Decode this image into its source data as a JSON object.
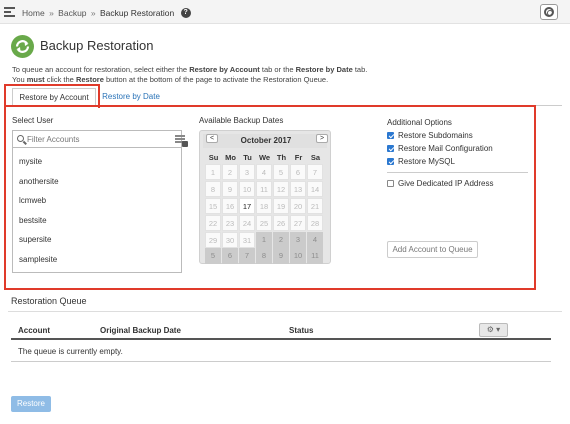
{
  "breadcrumb": {
    "home": "Home",
    "sep1": "»",
    "section": "Backup",
    "sep2": "»",
    "current": "Backup Restoration",
    "help": "?"
  },
  "page": {
    "title": "Backup Restoration",
    "intro_1a": "To queue an account for restoration, select either the ",
    "intro_1b": "Restore by Account",
    "intro_1c": " tab or the ",
    "intro_1d": "Restore by Date",
    "intro_1e": " tab.",
    "intro_2a": "You ",
    "intro_2b": "must",
    "intro_2c": " click the ",
    "intro_2d": "Restore",
    "intro_2e": " button at the bottom of the page to activate the Restoration Queue."
  },
  "tabs": [
    {
      "label": "Restore by Account",
      "active": true
    },
    {
      "label": "Restore by Date",
      "active": false
    }
  ],
  "select_user": {
    "label": "Select User",
    "placeholder": "Filter Accounts",
    "accounts": [
      "mysite",
      "anothersite",
      "lcmweb",
      "bestsite",
      "supersite",
      "samplesite"
    ]
  },
  "calendar": {
    "label": "Available Backup Dates",
    "prev": "<",
    "next": ">",
    "month": "October 2017",
    "weekdays": [
      "Su",
      "Mo",
      "Tu",
      "We",
      "Th",
      "Fr",
      "Sa"
    ],
    "weeks": [
      [
        "1",
        "2",
        "3",
        "4",
        "5",
        "6",
        "7"
      ],
      [
        "8",
        "9",
        "10",
        "11",
        "12",
        "13",
        "14"
      ],
      [
        "15",
        "16",
        "17",
        "18",
        "19",
        "20",
        "21"
      ],
      [
        "22",
        "23",
        "24",
        "25",
        "26",
        "27",
        "28"
      ],
      [
        "29",
        "30",
        "31",
        "1",
        "2",
        "3",
        "4"
      ],
      [
        "5",
        "6",
        "7",
        "8",
        "9",
        "10",
        "11"
      ]
    ],
    "available_day": "17"
  },
  "options": {
    "label": "Additional Options",
    "restore_subdomains": "Restore Subdomains",
    "restore_mail": "Restore Mail Configuration",
    "restore_mysql": "Restore MySQL",
    "dedicated_ip": "Give Dedicated IP Address",
    "add_button": "Add Account to Queue"
  },
  "queue": {
    "title": "Restoration Queue",
    "col_account": "Account",
    "col_date": "Original Backup Date",
    "col_status": "Status",
    "gear": "⚙ ▾",
    "empty": "The queue is currently empty."
  },
  "restore_button": "Restore",
  "colors": {
    "highlight": "#e03a2a",
    "accent_blue": "#2a73b8",
    "title_icon": "#69a94a",
    "restore_button": "#8fbce6"
  }
}
